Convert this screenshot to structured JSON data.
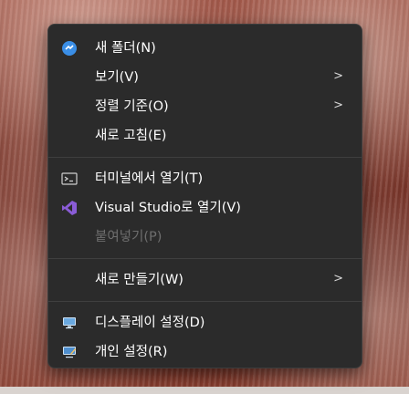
{
  "menu": {
    "items": [
      {
        "label": "새 폴더(N)",
        "icon": "new-folder-icon"
      },
      {
        "label": "보기(V)",
        "arrow": ">"
      },
      {
        "label": "정렬 기준(O)",
        "arrow": ">"
      },
      {
        "label": "새로 고침(E)"
      },
      {
        "label": "터미널에서 열기(T)",
        "icon": "terminal-icon"
      },
      {
        "label": "Visual Studio로 열기(V)",
        "icon": "visual-studio-icon"
      },
      {
        "label": "붙여넣기(P)",
        "disabled": true
      },
      {
        "label": "새로 만들기(W)",
        "arrow": ">"
      },
      {
        "label": "디스플레이 설정(D)",
        "icon": "display-icon"
      },
      {
        "label": "개인 설정(R)",
        "icon": "personalize-icon"
      }
    ]
  },
  "colors": {
    "menu_bg": "#2b2b2b",
    "text": "#ffffff",
    "disabled_text": "#6e6e6e",
    "accent_blue": "#3a8ee6"
  }
}
